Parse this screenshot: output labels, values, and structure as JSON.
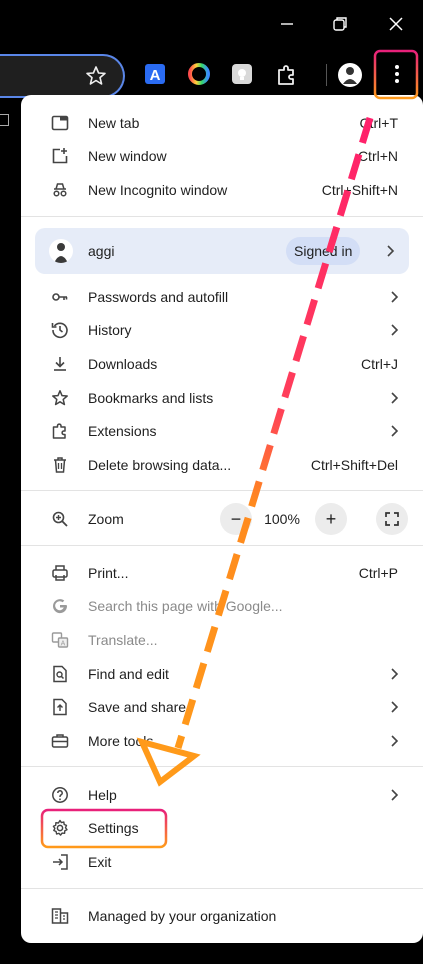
{
  "menu": {
    "new_tab": {
      "label": "New tab",
      "shortcut": "Ctrl+T"
    },
    "new_window": {
      "label": "New window",
      "shortcut": "Ctrl+N"
    },
    "new_incognito": {
      "label": "New Incognito window",
      "shortcut": "Ctrl+Shift+N"
    },
    "profile": {
      "name": "aggi",
      "badge": "Signed in"
    },
    "passwords": {
      "label": "Passwords and autofill"
    },
    "history": {
      "label": "History"
    },
    "downloads": {
      "label": "Downloads",
      "shortcut": "Ctrl+J"
    },
    "bookmarks": {
      "label": "Bookmarks and lists"
    },
    "extensions": {
      "label": "Extensions"
    },
    "delete_data": {
      "label": "Delete browsing data...",
      "shortcut": "Ctrl+Shift+Del"
    },
    "zoom": {
      "label": "Zoom",
      "minus": "−",
      "value": "100%",
      "plus": "+"
    },
    "print": {
      "label": "Print...",
      "shortcut": "Ctrl+P"
    },
    "search_page": {
      "label": "Search this page with Google..."
    },
    "translate": {
      "label": "Translate..."
    },
    "find_edit": {
      "label": "Find and edit"
    },
    "save_share": {
      "label": "Save and share"
    },
    "more_tools": {
      "label": "More tools"
    },
    "help": {
      "label": "Help"
    },
    "settings": {
      "label": "Settings"
    },
    "exit": {
      "label": "Exit"
    },
    "managed": {
      "label": "Managed by your organization"
    }
  },
  "colors": {
    "arrow_pink": "#ff1f6b",
    "arrow_orange": "#ff9a1a",
    "highlight_pink": "#e8207a",
    "highlight_orange": "#ff9a1a",
    "profile_bg": "#e6ecf8"
  },
  "icons": [
    "minimize-icon",
    "restore-icon",
    "close-icon",
    "star-icon",
    "translate-ext-icon",
    "color-ext-icon",
    "bulb-ext-icon",
    "puzzle-icon",
    "avatar-icon",
    "kebab-menu-icon"
  ]
}
